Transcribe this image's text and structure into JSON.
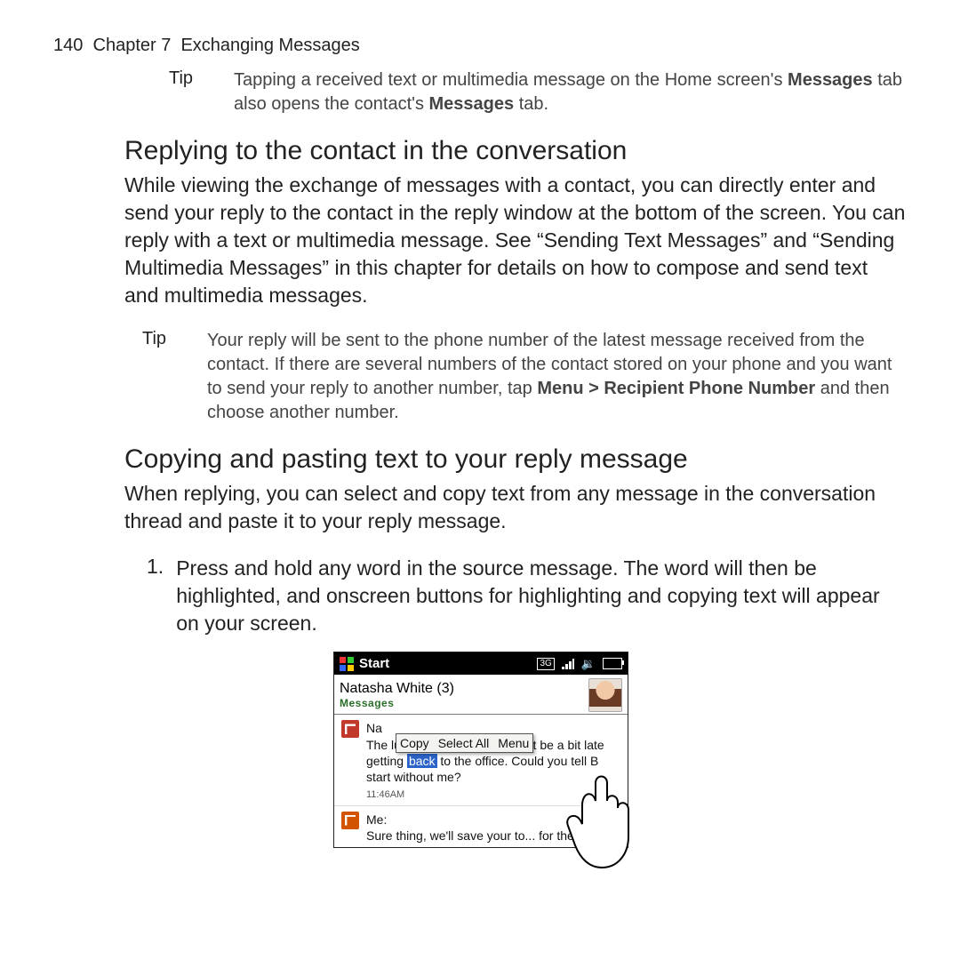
{
  "running_head": {
    "page": "140",
    "chapter": "Chapter 7",
    "title": "Exchanging Messages"
  },
  "tip1": {
    "label": "Tip",
    "text_a": "Tapping a received text or multimedia message on the Home screen's ",
    "bold_a": "Messages",
    "text_b": " tab also opens the contact's ",
    "bold_b": "Messages",
    "text_c": " tab."
  },
  "section1": {
    "heading": "Replying to the contact in the conversation",
    "para": "While viewing the exchange of messages with a contact, you can directly enter and send your reply to the contact in the reply window at the bottom of the screen. You can reply with a text or multimedia message. See “Sending Text Messages” and “Sending Multimedia Messages” in this chapter for details on how to compose and send text and multimedia messages."
  },
  "tip2": {
    "label": "Tip",
    "text_a": "Your reply will be sent to the phone number of the latest message received from the contact. If there are several numbers of the contact stored on your phone and you want to send your reply to another number, tap ",
    "bold_a": "Menu > Recipient Phone Number",
    "text_b": " and then choose another number."
  },
  "section2": {
    "heading": "Copying and pasting text to your reply message",
    "para": "When replying, you can select and copy text from any message in the conversation thread and paste it to your reply message.",
    "step_num": "1.",
    "step_text": "Press and hold any word in the source message. The word will then be highlighted, and onscreen buttons for highlighting and copying text will appear on your screen."
  },
  "phone": {
    "start": "Start",
    "icon_3g": "3G",
    "contact": "Natasha White (3)",
    "subhead": "Messages",
    "popup_copy": "Copy",
    "popup_selectall": "Select All",
    "popup_menu": "Menu",
    "msg1_sender": "Na",
    "msg1_a": "The lunch is going great. Might be a bit late getting ",
    "msg1_hi": "back",
    "msg1_b": " to the office. Could you tell B",
    "msg1_c": " start without me?",
    "msg1_time": "11:46AM",
    "msg2_sender": "Me:",
    "msg2_text": "Sure thing, we'll save your to... for the end."
  }
}
